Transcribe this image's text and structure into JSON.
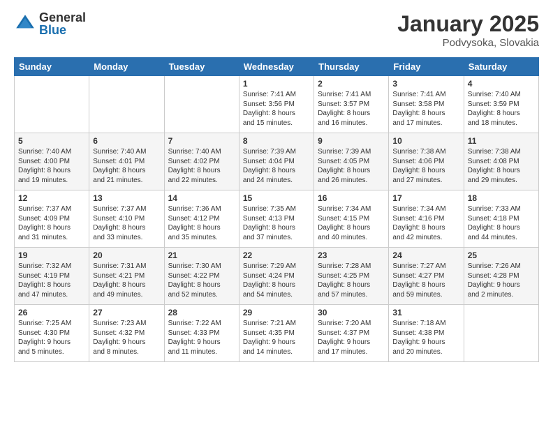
{
  "logo": {
    "general": "General",
    "blue": "Blue"
  },
  "header": {
    "month": "January 2025",
    "location": "Podvysoka, Slovakia"
  },
  "weekdays": [
    "Sunday",
    "Monday",
    "Tuesday",
    "Wednesday",
    "Thursday",
    "Friday",
    "Saturday"
  ],
  "weeks": [
    [
      {
        "day": "",
        "info": ""
      },
      {
        "day": "",
        "info": ""
      },
      {
        "day": "",
        "info": ""
      },
      {
        "day": "1",
        "info": "Sunrise: 7:41 AM\nSunset: 3:56 PM\nDaylight: 8 hours\nand 15 minutes."
      },
      {
        "day": "2",
        "info": "Sunrise: 7:41 AM\nSunset: 3:57 PM\nDaylight: 8 hours\nand 16 minutes."
      },
      {
        "day": "3",
        "info": "Sunrise: 7:41 AM\nSunset: 3:58 PM\nDaylight: 8 hours\nand 17 minutes."
      },
      {
        "day": "4",
        "info": "Sunrise: 7:40 AM\nSunset: 3:59 PM\nDaylight: 8 hours\nand 18 minutes."
      }
    ],
    [
      {
        "day": "5",
        "info": "Sunrise: 7:40 AM\nSunset: 4:00 PM\nDaylight: 8 hours\nand 19 minutes."
      },
      {
        "day": "6",
        "info": "Sunrise: 7:40 AM\nSunset: 4:01 PM\nDaylight: 8 hours\nand 21 minutes."
      },
      {
        "day": "7",
        "info": "Sunrise: 7:40 AM\nSunset: 4:02 PM\nDaylight: 8 hours\nand 22 minutes."
      },
      {
        "day": "8",
        "info": "Sunrise: 7:39 AM\nSunset: 4:04 PM\nDaylight: 8 hours\nand 24 minutes."
      },
      {
        "day": "9",
        "info": "Sunrise: 7:39 AM\nSunset: 4:05 PM\nDaylight: 8 hours\nand 26 minutes."
      },
      {
        "day": "10",
        "info": "Sunrise: 7:38 AM\nSunset: 4:06 PM\nDaylight: 8 hours\nand 27 minutes."
      },
      {
        "day": "11",
        "info": "Sunrise: 7:38 AM\nSunset: 4:08 PM\nDaylight: 8 hours\nand 29 minutes."
      }
    ],
    [
      {
        "day": "12",
        "info": "Sunrise: 7:37 AM\nSunset: 4:09 PM\nDaylight: 8 hours\nand 31 minutes."
      },
      {
        "day": "13",
        "info": "Sunrise: 7:37 AM\nSunset: 4:10 PM\nDaylight: 8 hours\nand 33 minutes."
      },
      {
        "day": "14",
        "info": "Sunrise: 7:36 AM\nSunset: 4:12 PM\nDaylight: 8 hours\nand 35 minutes."
      },
      {
        "day": "15",
        "info": "Sunrise: 7:35 AM\nSunset: 4:13 PM\nDaylight: 8 hours\nand 37 minutes."
      },
      {
        "day": "16",
        "info": "Sunrise: 7:34 AM\nSunset: 4:15 PM\nDaylight: 8 hours\nand 40 minutes."
      },
      {
        "day": "17",
        "info": "Sunrise: 7:34 AM\nSunset: 4:16 PM\nDaylight: 8 hours\nand 42 minutes."
      },
      {
        "day": "18",
        "info": "Sunrise: 7:33 AM\nSunset: 4:18 PM\nDaylight: 8 hours\nand 44 minutes."
      }
    ],
    [
      {
        "day": "19",
        "info": "Sunrise: 7:32 AM\nSunset: 4:19 PM\nDaylight: 8 hours\nand 47 minutes."
      },
      {
        "day": "20",
        "info": "Sunrise: 7:31 AM\nSunset: 4:21 PM\nDaylight: 8 hours\nand 49 minutes."
      },
      {
        "day": "21",
        "info": "Sunrise: 7:30 AM\nSunset: 4:22 PM\nDaylight: 8 hours\nand 52 minutes."
      },
      {
        "day": "22",
        "info": "Sunrise: 7:29 AM\nSunset: 4:24 PM\nDaylight: 8 hours\nand 54 minutes."
      },
      {
        "day": "23",
        "info": "Sunrise: 7:28 AM\nSunset: 4:25 PM\nDaylight: 8 hours\nand 57 minutes."
      },
      {
        "day": "24",
        "info": "Sunrise: 7:27 AM\nSunset: 4:27 PM\nDaylight: 8 hours\nand 59 minutes."
      },
      {
        "day": "25",
        "info": "Sunrise: 7:26 AM\nSunset: 4:28 PM\nDaylight: 9 hours\nand 2 minutes."
      }
    ],
    [
      {
        "day": "26",
        "info": "Sunrise: 7:25 AM\nSunset: 4:30 PM\nDaylight: 9 hours\nand 5 minutes."
      },
      {
        "day": "27",
        "info": "Sunrise: 7:23 AM\nSunset: 4:32 PM\nDaylight: 9 hours\nand 8 minutes."
      },
      {
        "day": "28",
        "info": "Sunrise: 7:22 AM\nSunset: 4:33 PM\nDaylight: 9 hours\nand 11 minutes."
      },
      {
        "day": "29",
        "info": "Sunrise: 7:21 AM\nSunset: 4:35 PM\nDaylight: 9 hours\nand 14 minutes."
      },
      {
        "day": "30",
        "info": "Sunrise: 7:20 AM\nSunset: 4:37 PM\nDaylight: 9 hours\nand 17 minutes."
      },
      {
        "day": "31",
        "info": "Sunrise: 7:18 AM\nSunset: 4:38 PM\nDaylight: 9 hours\nand 20 minutes."
      },
      {
        "day": "",
        "info": ""
      }
    ]
  ]
}
